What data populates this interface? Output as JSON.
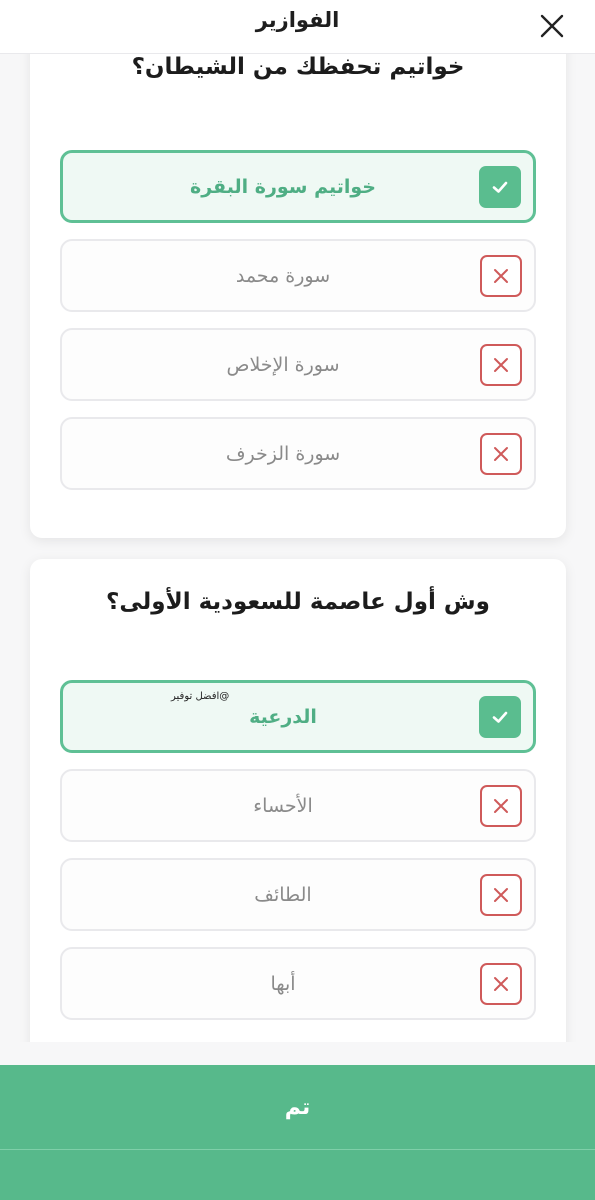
{
  "header": {
    "title": "الفوازير",
    "close_icon": "close-icon"
  },
  "questions": [
    {
      "text": "خواتيم تحفظك من الشيطان؟",
      "options": [
        {
          "label": "خواتيم سورة البقرة",
          "correct": true
        },
        {
          "label": "سورة محمد",
          "correct": false
        },
        {
          "label": "سورة الإخلاص",
          "correct": false
        },
        {
          "label": "سورة الزخرف",
          "correct": false
        }
      ]
    },
    {
      "text": "وش أول عاصمة للسعودية الأولى؟",
      "watermark": "@افضل توفير",
      "options": [
        {
          "label": "الدرعية",
          "correct": true
        },
        {
          "label": "الأحساء",
          "correct": false
        },
        {
          "label": "الطائف",
          "correct": false
        },
        {
          "label": "أبها",
          "correct": false
        }
      ]
    }
  ],
  "footer": {
    "done_label": "تم"
  },
  "colors": {
    "accent_green": "#57b98b",
    "correct_border": "#5fc095",
    "wrong_red": "#cf5a5a"
  }
}
